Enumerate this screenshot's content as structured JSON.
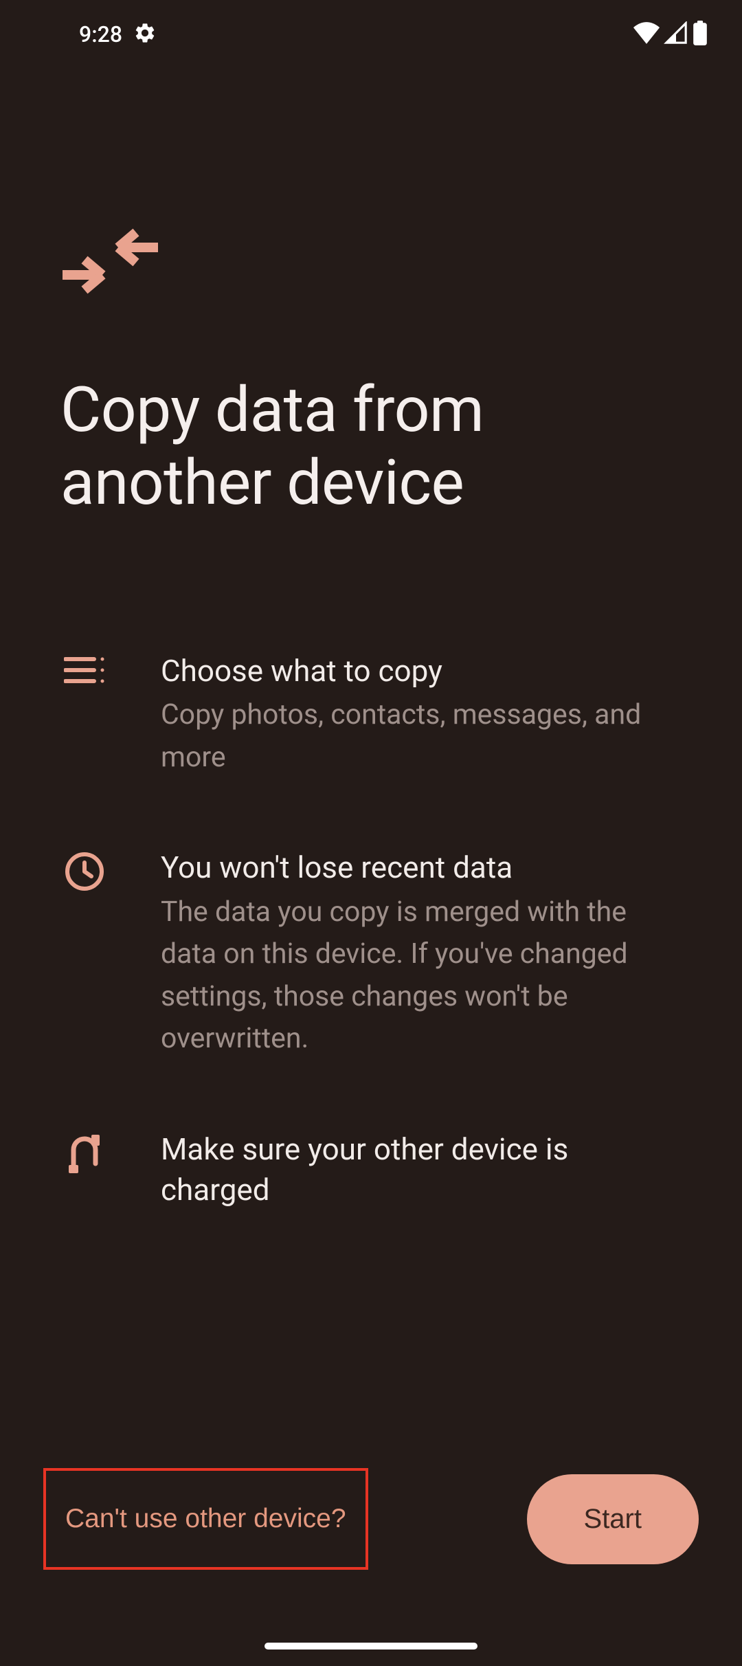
{
  "status_bar": {
    "time": "9:28"
  },
  "page": {
    "title": "Copy data from another device"
  },
  "info_items": [
    {
      "icon": "list-icon",
      "title": "Choose what to copy",
      "subtitle": "Copy photos, contacts, messages, and more"
    },
    {
      "icon": "clock-icon",
      "title": "You won't lose recent data",
      "subtitle": "The data you copy is merged with the data on this device. If you've changed settings, those changes won't be overwritten."
    },
    {
      "icon": "cable-icon",
      "title": "Make sure your other device is charged",
      "subtitle": ""
    }
  ],
  "footer": {
    "secondary_label": "Can't use other device?",
    "primary_label": "Start"
  },
  "colors": {
    "accent": "#e9a38f",
    "accent_text": "#e4987f",
    "highlight_border": "#e73424"
  }
}
